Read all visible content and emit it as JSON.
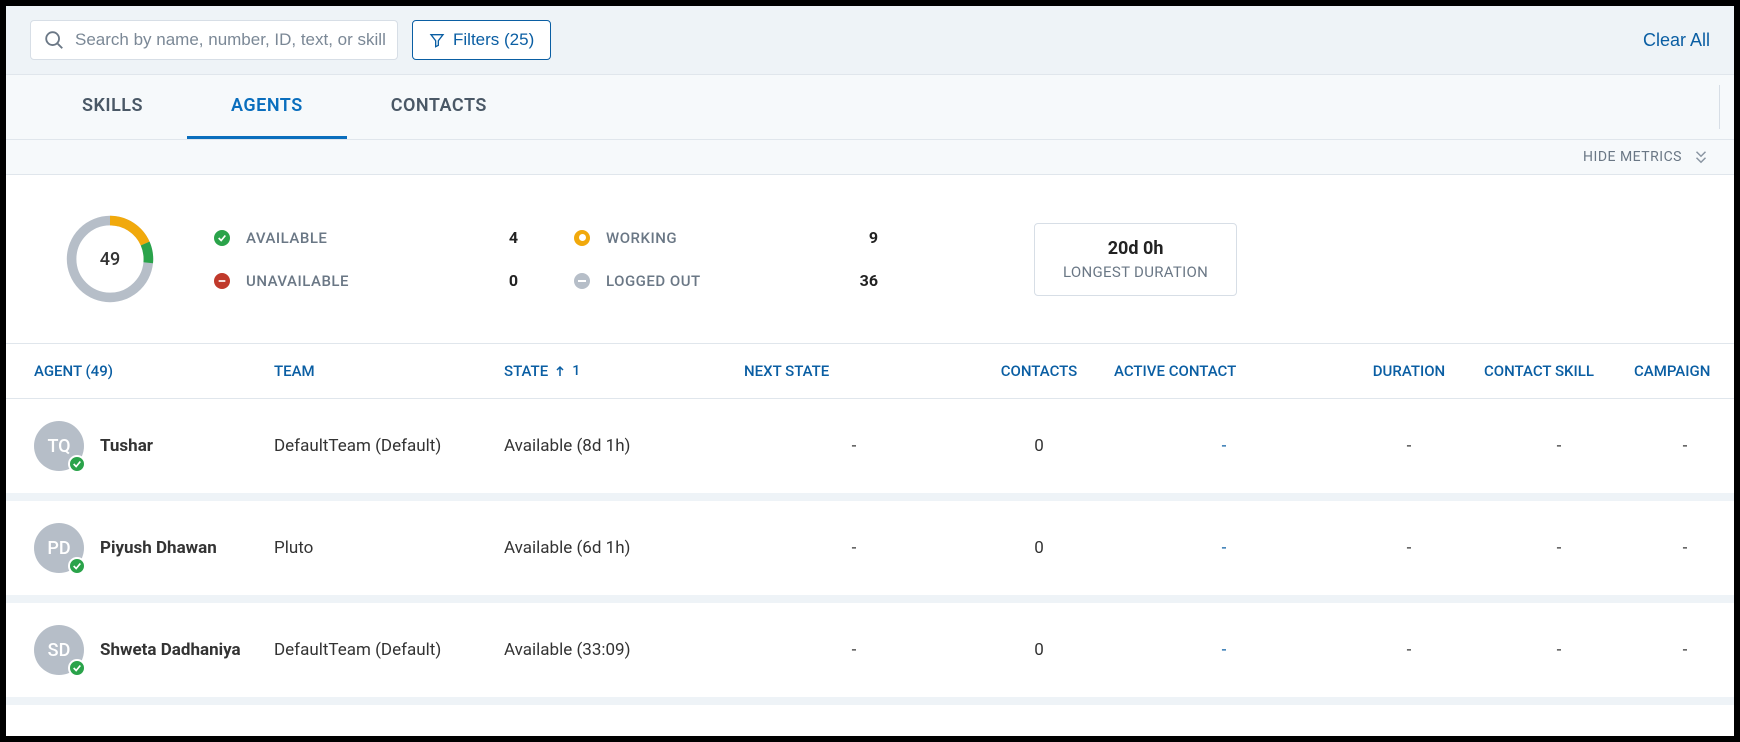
{
  "search": {
    "placeholder": "Search by name, number, ID, text, or skill"
  },
  "filters": {
    "label": "Filters (25)"
  },
  "clear_all": "Clear All",
  "tabs": [
    {
      "label": "SKILLS",
      "active": false
    },
    {
      "label": "AGENTS",
      "active": true
    },
    {
      "label": "CONTACTS",
      "active": false
    }
  ],
  "hide_metrics": "HIDE METRICS",
  "metrics": {
    "total": "49",
    "legend_a": [
      {
        "label": "AVAILABLE",
        "value": "4"
      },
      {
        "label": "UNAVAILABLE",
        "value": "0"
      }
    ],
    "legend_b": [
      {
        "label": "WORKING",
        "value": "9"
      },
      {
        "label": "LOGGED OUT",
        "value": "36"
      }
    ],
    "duration": {
      "value": "20d 0h",
      "label": "LONGEST DURATION"
    }
  },
  "columns": {
    "agent": "AGENT (49)",
    "team": "TEAM",
    "state": "STATE",
    "state_sort": "1",
    "next_state": "NEXT STATE",
    "contacts": "CONTACTS",
    "active_contact": "ACTIVE CONTACT",
    "duration": "DURATION",
    "contact_skill": "CONTACT SKILL",
    "campaign": "CAMPAIGN"
  },
  "rows": [
    {
      "initials": "TQ",
      "name": "Tushar",
      "team": "DefaultTeam (Default)",
      "state": "Available (8d 1h)",
      "next_state": "-",
      "contacts": "0",
      "active_contact": "-",
      "duration": "-",
      "contact_skill": "-",
      "campaign": "-"
    },
    {
      "initials": "PD",
      "name": "Piyush Dhawan",
      "team": "Pluto",
      "state": "Available (6d 1h)",
      "next_state": "-",
      "contacts": "0",
      "active_contact": "-",
      "duration": "-",
      "contact_skill": "-",
      "campaign": "-"
    },
    {
      "initials": "SD",
      "name": "Shweta Dadhaniya",
      "team": "DefaultTeam (Default)",
      "state": "Available (33:09)",
      "next_state": "-",
      "contacts": "0",
      "active_contact": "-",
      "duration": "-",
      "contact_skill": "-",
      "campaign": "-"
    }
  ],
  "chart_data": {
    "type": "pie",
    "title": "",
    "categories": [
      "Available",
      "Unavailable",
      "Working",
      "Logged Out"
    ],
    "values": [
      4,
      0,
      9,
      36
    ],
    "total": 49,
    "colors": [
      "#2aa34a",
      "#c0392b",
      "#f1a90c",
      "#b6bec8"
    ]
  }
}
